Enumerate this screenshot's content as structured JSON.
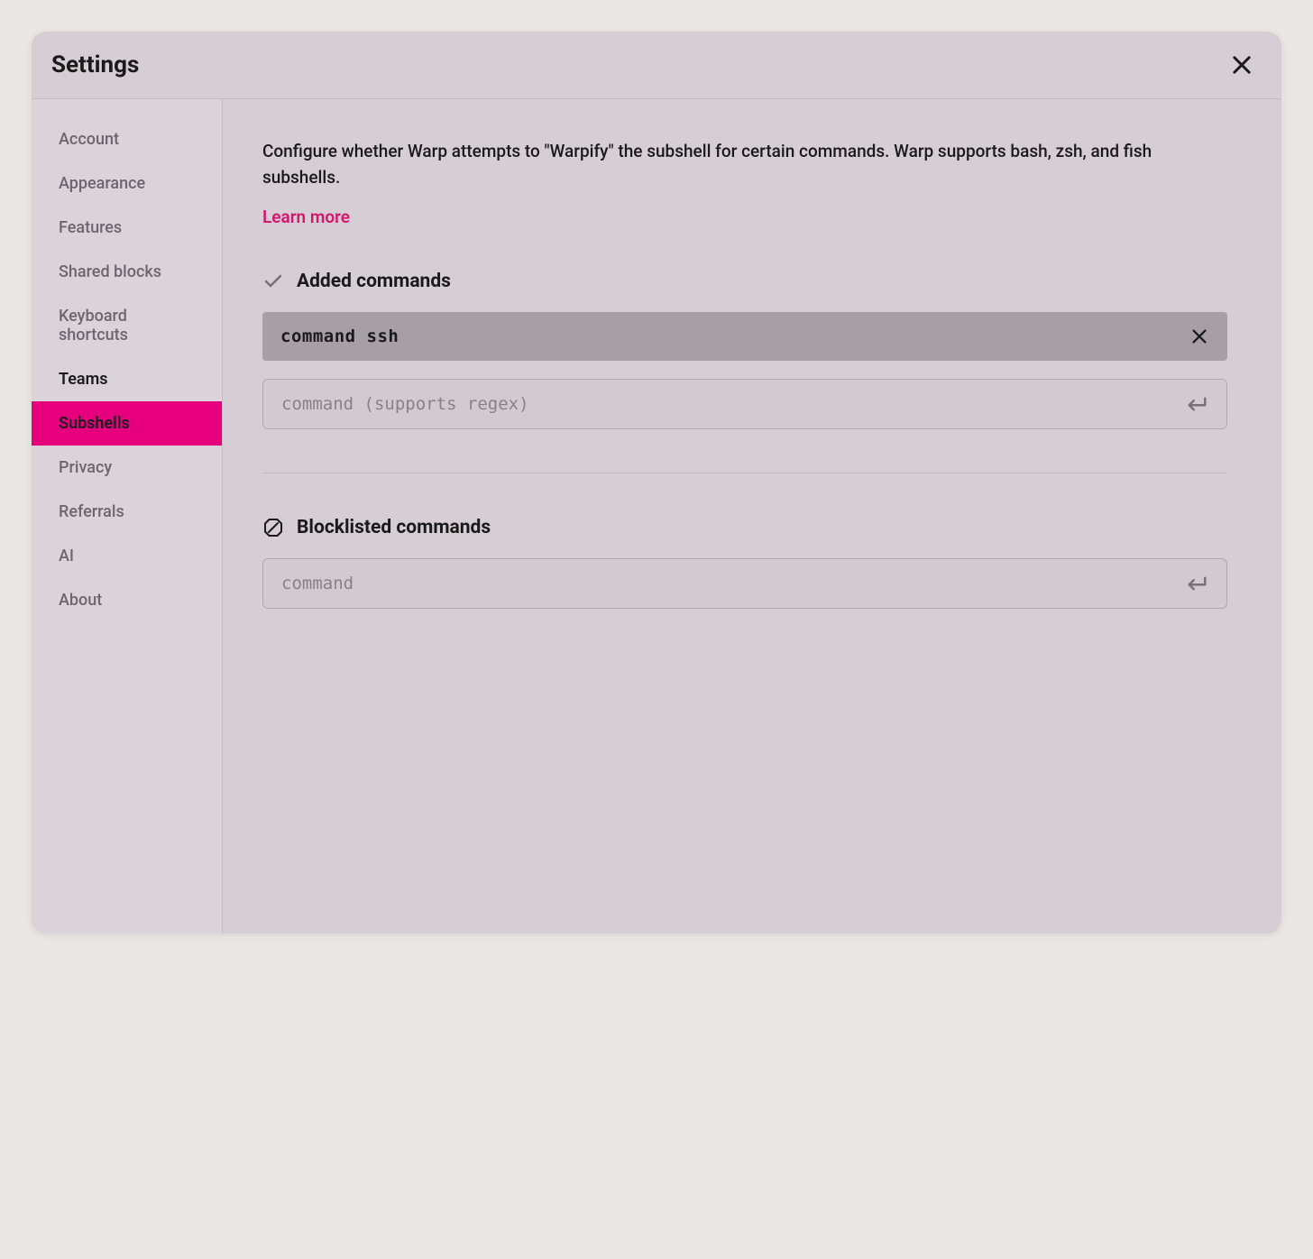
{
  "header": {
    "title": "Settings"
  },
  "sidebar": {
    "items": [
      {
        "label": "Account",
        "active": false,
        "emphasis": false
      },
      {
        "label": "Appearance",
        "active": false,
        "emphasis": false
      },
      {
        "label": "Features",
        "active": false,
        "emphasis": false
      },
      {
        "label": "Shared blocks",
        "active": false,
        "emphasis": false
      },
      {
        "label": "Keyboard shortcuts",
        "active": false,
        "emphasis": false
      },
      {
        "label": "Teams",
        "active": false,
        "emphasis": true
      },
      {
        "label": "Subshells",
        "active": true,
        "emphasis": false
      },
      {
        "label": "Privacy",
        "active": false,
        "emphasis": false
      },
      {
        "label": "Referrals",
        "active": false,
        "emphasis": false
      },
      {
        "label": "AI",
        "active": false,
        "emphasis": false
      },
      {
        "label": "About",
        "active": false,
        "emphasis": false
      }
    ]
  },
  "main": {
    "description": "Configure whether Warp attempts to \"Warpify\" the subshell for certain commands. Warp supports bash, zsh, and fish subshells.",
    "learn_more": "Learn more",
    "sections": {
      "added": {
        "title": "Added commands",
        "chips": [
          {
            "text": "command ssh"
          }
        ],
        "input_placeholder": "command (supports regex)"
      },
      "blocklisted": {
        "title": "Blocklisted commands",
        "input_placeholder": "command"
      }
    }
  },
  "colors": {
    "accent": "#e6007e",
    "link": "#d6156e"
  }
}
